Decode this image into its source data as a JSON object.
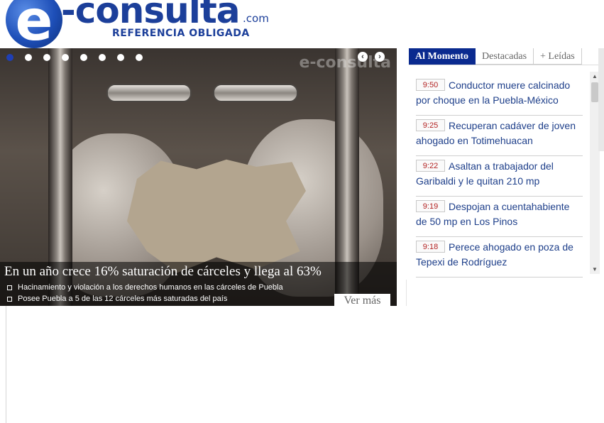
{
  "logo": {
    "letter": "e",
    "word": "-consulta",
    "tld": ".com",
    "tagline": "REFERENCIA OBLIGADA"
  },
  "slider": {
    "watermark": "e-consulta",
    "dot_count": 8,
    "active_dot": 1,
    "prev_label": "‹",
    "next_label": "›",
    "headline": "En un año crece 16% saturación de cárceles y llega al 63%",
    "bullets": [
      "Hacinamiento y violación a los derechos humanos en las cárceles de Puebla",
      "Posee Puebla a 5 de las 12 cárceles más saturadas del país"
    ],
    "more_label": "Ver más"
  },
  "panel": {
    "tabs": [
      {
        "label": "Al Momento",
        "active": true
      },
      {
        "label": "Destacadas",
        "active": false
      },
      {
        "label": "+ Leídas",
        "active": false
      }
    ],
    "news": [
      {
        "time": "9:50",
        "text": "Conductor muere calcinado por choque en la Puebla-México"
      },
      {
        "time": "9:25",
        "text": "Recuperan cadáver de joven ahogado en Totimehuacan"
      },
      {
        "time": "9:22",
        "text": "Asaltan a trabajador del Garibaldi y le quitan 210 mp"
      },
      {
        "time": "9:19",
        "text": "Despojan a cuentahabiente de 50 mp en Los Pinos"
      },
      {
        "time": "9:18",
        "text": "Perece ahogado en poza de Tepexi de Rodríguez"
      }
    ],
    "scroll_up": "▲",
    "scroll_down": "▼"
  },
  "colors": {
    "brand_blue": "#1c3f9a",
    "tab_active": "#0a2a8f",
    "time_red": "#b22222",
    "link_blue": "#1e3f8a"
  }
}
